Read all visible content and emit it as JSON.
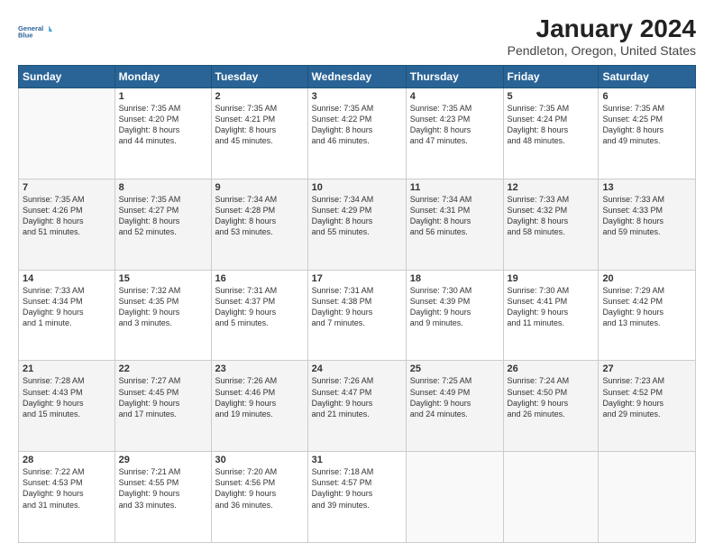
{
  "header": {
    "logo_line1": "General",
    "logo_line2": "Blue",
    "title": "January 2024",
    "subtitle": "Pendleton, Oregon, United States"
  },
  "days_of_week": [
    "Sunday",
    "Monday",
    "Tuesday",
    "Wednesday",
    "Thursday",
    "Friday",
    "Saturday"
  ],
  "weeks": [
    [
      {
        "day": "",
        "info": ""
      },
      {
        "day": "1",
        "info": "Sunrise: 7:35 AM\nSunset: 4:20 PM\nDaylight: 8 hours\nand 44 minutes."
      },
      {
        "day": "2",
        "info": "Sunrise: 7:35 AM\nSunset: 4:21 PM\nDaylight: 8 hours\nand 45 minutes."
      },
      {
        "day": "3",
        "info": "Sunrise: 7:35 AM\nSunset: 4:22 PM\nDaylight: 8 hours\nand 46 minutes."
      },
      {
        "day": "4",
        "info": "Sunrise: 7:35 AM\nSunset: 4:23 PM\nDaylight: 8 hours\nand 47 minutes."
      },
      {
        "day": "5",
        "info": "Sunrise: 7:35 AM\nSunset: 4:24 PM\nDaylight: 8 hours\nand 48 minutes."
      },
      {
        "day": "6",
        "info": "Sunrise: 7:35 AM\nSunset: 4:25 PM\nDaylight: 8 hours\nand 49 minutes."
      }
    ],
    [
      {
        "day": "7",
        "info": "Sunrise: 7:35 AM\nSunset: 4:26 PM\nDaylight: 8 hours\nand 51 minutes."
      },
      {
        "day": "8",
        "info": "Sunrise: 7:35 AM\nSunset: 4:27 PM\nDaylight: 8 hours\nand 52 minutes."
      },
      {
        "day": "9",
        "info": "Sunrise: 7:34 AM\nSunset: 4:28 PM\nDaylight: 8 hours\nand 53 minutes."
      },
      {
        "day": "10",
        "info": "Sunrise: 7:34 AM\nSunset: 4:29 PM\nDaylight: 8 hours\nand 55 minutes."
      },
      {
        "day": "11",
        "info": "Sunrise: 7:34 AM\nSunset: 4:31 PM\nDaylight: 8 hours\nand 56 minutes."
      },
      {
        "day": "12",
        "info": "Sunrise: 7:33 AM\nSunset: 4:32 PM\nDaylight: 8 hours\nand 58 minutes."
      },
      {
        "day": "13",
        "info": "Sunrise: 7:33 AM\nSunset: 4:33 PM\nDaylight: 8 hours\nand 59 minutes."
      }
    ],
    [
      {
        "day": "14",
        "info": "Sunrise: 7:33 AM\nSunset: 4:34 PM\nDaylight: 9 hours\nand 1 minute."
      },
      {
        "day": "15",
        "info": "Sunrise: 7:32 AM\nSunset: 4:35 PM\nDaylight: 9 hours\nand 3 minutes."
      },
      {
        "day": "16",
        "info": "Sunrise: 7:31 AM\nSunset: 4:37 PM\nDaylight: 9 hours\nand 5 minutes."
      },
      {
        "day": "17",
        "info": "Sunrise: 7:31 AM\nSunset: 4:38 PM\nDaylight: 9 hours\nand 7 minutes."
      },
      {
        "day": "18",
        "info": "Sunrise: 7:30 AM\nSunset: 4:39 PM\nDaylight: 9 hours\nand 9 minutes."
      },
      {
        "day": "19",
        "info": "Sunrise: 7:30 AM\nSunset: 4:41 PM\nDaylight: 9 hours\nand 11 minutes."
      },
      {
        "day": "20",
        "info": "Sunrise: 7:29 AM\nSunset: 4:42 PM\nDaylight: 9 hours\nand 13 minutes."
      }
    ],
    [
      {
        "day": "21",
        "info": "Sunrise: 7:28 AM\nSunset: 4:43 PM\nDaylight: 9 hours\nand 15 minutes."
      },
      {
        "day": "22",
        "info": "Sunrise: 7:27 AM\nSunset: 4:45 PM\nDaylight: 9 hours\nand 17 minutes."
      },
      {
        "day": "23",
        "info": "Sunrise: 7:26 AM\nSunset: 4:46 PM\nDaylight: 9 hours\nand 19 minutes."
      },
      {
        "day": "24",
        "info": "Sunrise: 7:26 AM\nSunset: 4:47 PM\nDaylight: 9 hours\nand 21 minutes."
      },
      {
        "day": "25",
        "info": "Sunrise: 7:25 AM\nSunset: 4:49 PM\nDaylight: 9 hours\nand 24 minutes."
      },
      {
        "day": "26",
        "info": "Sunrise: 7:24 AM\nSunset: 4:50 PM\nDaylight: 9 hours\nand 26 minutes."
      },
      {
        "day": "27",
        "info": "Sunrise: 7:23 AM\nSunset: 4:52 PM\nDaylight: 9 hours\nand 29 minutes."
      }
    ],
    [
      {
        "day": "28",
        "info": "Sunrise: 7:22 AM\nSunset: 4:53 PM\nDaylight: 9 hours\nand 31 minutes."
      },
      {
        "day": "29",
        "info": "Sunrise: 7:21 AM\nSunset: 4:55 PM\nDaylight: 9 hours\nand 33 minutes."
      },
      {
        "day": "30",
        "info": "Sunrise: 7:20 AM\nSunset: 4:56 PM\nDaylight: 9 hours\nand 36 minutes."
      },
      {
        "day": "31",
        "info": "Sunrise: 7:18 AM\nSunset: 4:57 PM\nDaylight: 9 hours\nand 39 minutes."
      },
      {
        "day": "",
        "info": ""
      },
      {
        "day": "",
        "info": ""
      },
      {
        "day": "",
        "info": ""
      }
    ]
  ]
}
